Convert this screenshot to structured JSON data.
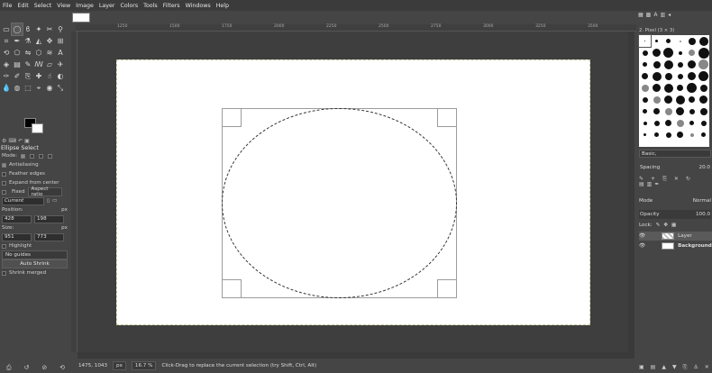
{
  "menu": [
    "File",
    "Edit",
    "Select",
    "View",
    "Image",
    "Layer",
    "Colors",
    "Tools",
    "Filters",
    "Windows",
    "Help"
  ],
  "toolbox": {
    "tools": [
      {
        "name": "rect-select-icon",
        "glyph": "▭",
        "active": false
      },
      {
        "name": "ellipse-select-icon",
        "glyph": "◯",
        "active": true
      },
      {
        "name": "free-select-icon",
        "glyph": "ϐ",
        "active": false
      },
      {
        "name": "fuzzy-select-icon",
        "glyph": "✦",
        "active": false
      },
      {
        "name": "scissors-select-icon",
        "glyph": "✂",
        "active": false
      },
      {
        "name": "zoom-icon",
        "glyph": "⚲",
        "active": false
      },
      {
        "name": "crop-icon",
        "glyph": "⌗",
        "active": false
      },
      {
        "name": "paths-icon",
        "glyph": "✒",
        "active": false
      },
      {
        "name": "color-picker-icon",
        "glyph": "⚗",
        "active": false
      },
      {
        "name": "measure-icon",
        "glyph": "◭",
        "active": false
      },
      {
        "name": "move-icon",
        "glyph": "✥",
        "active": false
      },
      {
        "name": "align-icon",
        "glyph": "⊞",
        "active": false
      },
      {
        "name": "transform-icon",
        "glyph": "⟲",
        "active": false
      },
      {
        "name": "perspective-icon",
        "glyph": "⬠",
        "active": false
      },
      {
        "name": "flip-icon",
        "glyph": "⇋",
        "active": false
      },
      {
        "name": "cage-icon",
        "glyph": "⬡",
        "active": false
      },
      {
        "name": "warp-icon",
        "glyph": "≋",
        "active": false
      },
      {
        "name": "text-icon",
        "glyph": "A",
        "active": false
      },
      {
        "name": "bucket-fill-icon",
        "glyph": "◈",
        "active": false
      },
      {
        "name": "gradient-icon",
        "glyph": "▤",
        "active": false
      },
      {
        "name": "pencil-icon",
        "glyph": "✎",
        "active": false
      },
      {
        "name": "paintbrush-icon",
        "glyph": "ꟿ",
        "active": false
      },
      {
        "name": "eraser-icon",
        "glyph": "▱",
        "active": false
      },
      {
        "name": "airbrush-icon",
        "glyph": "✈",
        "active": false
      },
      {
        "name": "ink-icon",
        "glyph": "✑",
        "active": false
      },
      {
        "name": "mypaint-brush-icon",
        "glyph": "✐",
        "active": false
      },
      {
        "name": "clone-icon",
        "glyph": "⎘",
        "active": false
      },
      {
        "name": "heal-icon",
        "glyph": "✚",
        "active": false
      },
      {
        "name": "smudge-icon",
        "glyph": "☝",
        "active": false
      },
      {
        "name": "dodge-burn-icon",
        "glyph": "◐",
        "active": false
      },
      {
        "name": "blur-icon",
        "glyph": "💧",
        "active": false
      },
      {
        "name": "foreground-select-icon",
        "glyph": "◍",
        "active": false
      },
      {
        "name": "unified-transform-icon",
        "glyph": "⬚",
        "active": false
      },
      {
        "name": "handle-transform-icon",
        "glyph": "⌖",
        "active": false
      },
      {
        "name": "color-icon",
        "glyph": "◉",
        "active": false
      },
      {
        "name": "scale-icon",
        "glyph": "⤡",
        "active": false
      }
    ],
    "colors": {
      "foreground": "#000000",
      "background": "#ffffff"
    }
  },
  "tool_options": {
    "title": "Ellipse Select",
    "mode_label": "Mode:",
    "antialiasing": "Antialiasing",
    "feather_edges": "Feather edges",
    "expand_from_center": "Expand from center",
    "fixed_label": "Fixed",
    "fixed_value": "Aspect ratio",
    "current_value": "Current",
    "position_label": "Position:",
    "position_unit": "px",
    "position_x": "428",
    "position_y": "198",
    "size_label": "Size:",
    "size_unit": "px",
    "size_w": "951",
    "size_h": "773",
    "highlight": "Highlight",
    "guides_value": "No guides",
    "auto_shrink": "Auto Shrink",
    "shrink_merged": "Shrink merged"
  },
  "rulers": {
    "marks": [
      "1250",
      "1500",
      "1750",
      "2000",
      "2250",
      "2500",
      "2750",
      "3000",
      "3250",
      "3500"
    ]
  },
  "status": {
    "coords": "1475, 1043",
    "unit": "px",
    "zoom": "16.7 %",
    "message": "Click-Drag to replace the current selection (try Shift, Ctrl, Alt)"
  },
  "brushes": {
    "name": "2. Pixel (3 × 3)",
    "tag": "Basic,",
    "spacing_label": "Spacing",
    "spacing_value": "20.0"
  },
  "layers": {
    "mode_label": "Mode",
    "mode_value": "Normal",
    "opacity_label": "Opacity",
    "opacity_value": "100.0",
    "lock_label": "Lock:",
    "items": [
      {
        "name": "Layer",
        "selected": true
      },
      {
        "name": "Background",
        "selected": false
      }
    ]
  }
}
